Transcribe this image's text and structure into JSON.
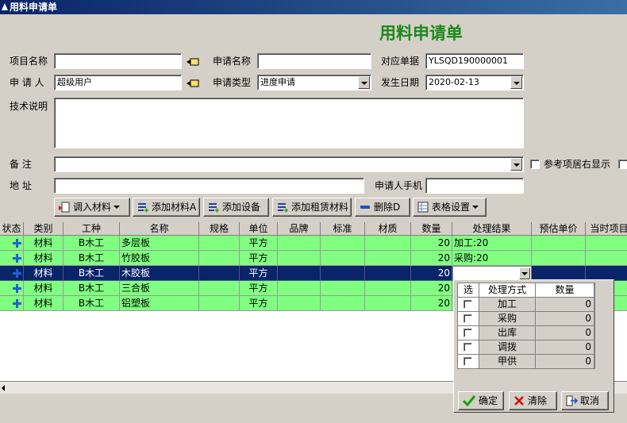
{
  "window": {
    "title": "用料申请单"
  },
  "form": {
    "title": "用料申请单",
    "project_name_label": "项目名称",
    "project_name_value": "",
    "request_name_label": "申请名称",
    "request_name_value": "",
    "order_label": "对应单据",
    "order_value": "YLSQD190000001",
    "applicant_label": "申 请 人",
    "applicant_value": "超级用户",
    "request_type_label": "申请类型",
    "request_type_value": "进度申请",
    "date_label": "发生日期",
    "date_value": "2020-02-13",
    "tech_label": "技术说明",
    "tech_value": "",
    "note_label": "备   注",
    "note_value": "",
    "ref_checkbox_label": "参考项居右显示",
    "address_label": "地   址",
    "address_value": "",
    "phone_label": "申请人手机",
    "phone_value": ""
  },
  "toolbar": {
    "import_label": "调入材料",
    "add_material_label": "添加材料A",
    "add_equipment_label": "添加设备",
    "add_rental_label": "添加租赁材料",
    "delete_label": "删除D",
    "table_settings_label": "表格设置"
  },
  "grid": {
    "columns": [
      "状态",
      "类别",
      "工种",
      "名称",
      "规格",
      "单位",
      "品牌",
      "标准",
      "材质",
      "数量",
      "处理结果",
      "预估单价",
      "当时项目"
    ],
    "rows": [
      {
        "category": "材料",
        "trade": "B木工",
        "name": "多层板",
        "spec": "",
        "unit": "平方",
        "brand": "",
        "standard": "",
        "material": "",
        "qty": "20",
        "result": "加工:20",
        "price": "",
        "project": ""
      },
      {
        "category": "材料",
        "trade": "B木工",
        "name": "竹胶板",
        "spec": "",
        "unit": "平方",
        "brand": "",
        "standard": "",
        "material": "",
        "qty": "20",
        "result": "采购:20",
        "price": "",
        "project": ""
      },
      {
        "category": "材料",
        "trade": "B木工",
        "name": "木胶板",
        "spec": "",
        "unit": "平方",
        "brand": "",
        "standard": "",
        "material": "",
        "qty": "20",
        "result": "",
        "price": "",
        "project": ""
      },
      {
        "category": "材料",
        "trade": "B木工",
        "name": "三合板",
        "spec": "",
        "unit": "平方",
        "brand": "",
        "standard": "",
        "material": "",
        "qty": "20",
        "result": "",
        "price": "",
        "project": ""
      },
      {
        "category": "材料",
        "trade": "B木工",
        "name": "铝塑板",
        "spec": "",
        "unit": "平方",
        "brand": "",
        "standard": "",
        "material": "",
        "qty": "20",
        "result": "",
        "price": "",
        "project": ""
      }
    ]
  },
  "popup": {
    "columns": [
      "选",
      "处理方式",
      "数量"
    ],
    "rows": [
      {
        "method": "加工",
        "qty": "0"
      },
      {
        "method": "采购",
        "qty": "0"
      },
      {
        "method": "出库",
        "qty": "0"
      },
      {
        "method": "调拨",
        "qty": "0"
      },
      {
        "method": "甲供",
        "qty": "0"
      }
    ],
    "ok_label": "确定",
    "clear_label": "清除",
    "cancel_label": "取消"
  },
  "colors": {
    "title_green": "#1a8a1a",
    "row_green": "#80ff80",
    "selection": "#0a246a"
  }
}
